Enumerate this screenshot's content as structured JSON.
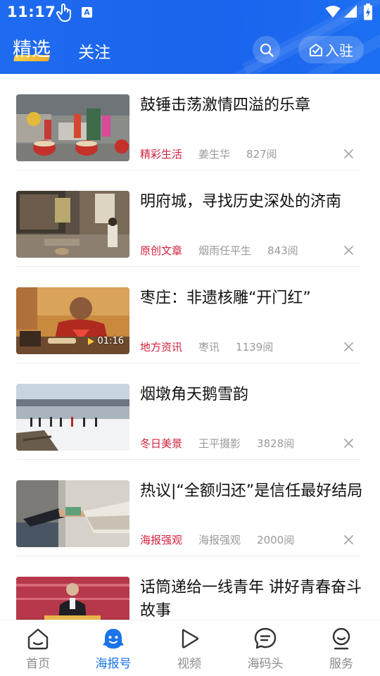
{
  "status_bar": {
    "time": "11:17",
    "input_badge": "A"
  },
  "header": {
    "tabs": [
      {
        "label": "精选",
        "selected": true
      },
      {
        "label": "关注",
        "selected": false
      }
    ],
    "join_label": "入驻"
  },
  "feed": [
    {
      "title": "鼓锤击荡激情四溢的乐章",
      "tag": "精彩生活",
      "author": "姜生华",
      "reads": "827阅"
    },
    {
      "title": "明府城，寻找历史深处的济南",
      "tag": "原创文章",
      "author": "烟雨任平生",
      "reads": "843阅"
    },
    {
      "title": "枣庄：非遗核雕“开门红”",
      "tag": "地方资讯",
      "author": "枣讯",
      "reads": "1139阅",
      "duration": "01:16"
    },
    {
      "title": "烟墩角天鹅雪韵",
      "tag": "冬日美景",
      "author": "王平摄影",
      "reads": "3828阅"
    },
    {
      "title": "热议|“全额归还”是信任最好结局",
      "tag": "海报强观",
      "author": "海报强观",
      "reads": "2000阅"
    },
    {
      "title": "话筒递给一线青年 讲好青春奋斗故事"
    }
  ],
  "bottom_nav": [
    {
      "label": "首页",
      "icon": "home-icon",
      "active": false
    },
    {
      "label": "海报号",
      "icon": "mascot-icon",
      "active": true
    },
    {
      "label": "视频",
      "icon": "play-icon",
      "active": false
    },
    {
      "label": "海码头",
      "icon": "chat-bubble-icon",
      "active": false
    },
    {
      "label": "服务",
      "icon": "service-icon",
      "active": false
    }
  ],
  "colors": {
    "brand_blue": "#1a63ec",
    "tag_red": "#d21f3c",
    "active_nav": "#1a73e8",
    "meta_gray": "#9a9a9a"
  }
}
